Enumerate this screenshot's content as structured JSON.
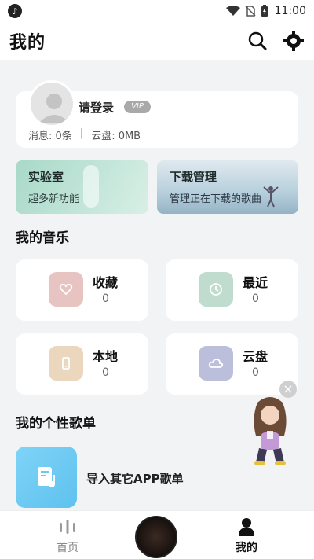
{
  "status_bar": {
    "time": "11:00"
  },
  "header": {
    "title": "我的"
  },
  "profile": {
    "login_text": "请登录",
    "vip_badge": "VIP",
    "messages": "消息: 0条",
    "separator": "|",
    "cloud": "云盘: 0MB"
  },
  "features": {
    "lab": {
      "title": "实验室",
      "subtitle": "超多新功能"
    },
    "download": {
      "title": "下载管理",
      "subtitle": "管理正在下载的歌曲"
    }
  },
  "my_music": {
    "section_title": "我的音乐",
    "items": [
      {
        "label": "收藏",
        "count": "0",
        "icon": "heart-icon",
        "color": "#e7c4c2"
      },
      {
        "label": "最近",
        "count": "0",
        "icon": "clock-icon",
        "color": "#bfdccf"
      },
      {
        "label": "本地",
        "count": "0",
        "icon": "phone-icon",
        "color": "#ead7bd"
      },
      {
        "label": "云盘",
        "count": "0",
        "icon": "cloud-icon",
        "color": "#bcbfdc"
      }
    ]
  },
  "playlists": {
    "section_title": "我的个性歌单",
    "import_label": "导入其它APP歌单"
  },
  "bottom_nav": {
    "home": "首页",
    "mine": "我的"
  },
  "colors": {
    "accent": "#111111",
    "inactive": "#8a8a8a",
    "import_thumb": "#6cc9f2"
  }
}
